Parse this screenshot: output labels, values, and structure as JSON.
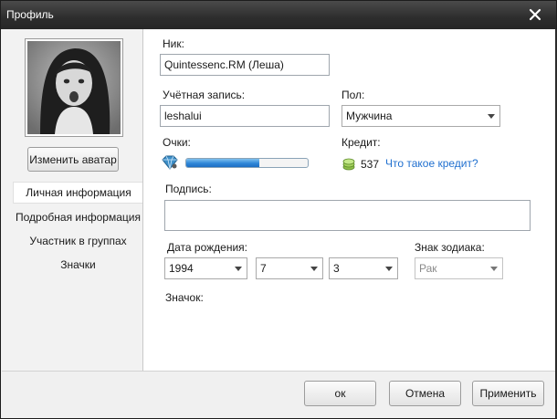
{
  "window": {
    "title": "Профиль"
  },
  "sidebar": {
    "change_avatar": "Изменить аватар",
    "items": [
      {
        "label": "Личная информация",
        "active": true
      },
      {
        "label": "Подробная информация"
      },
      {
        "label": "Участник в группах"
      },
      {
        "label": "Значки"
      }
    ]
  },
  "form": {
    "nick_label": "Ник:",
    "nick_value": "Quintessenc.RM (Леша)",
    "account_label": "Учётная запись:",
    "account_value": "leshalui",
    "gender_label": "Пол:",
    "gender_value": "Мужчина",
    "points_label": "Очки:",
    "points_progress": 0.6,
    "credit_label": "Кредит:",
    "credit_value": "537",
    "credit_link": "Что такое кредит?",
    "signature_label": "Подпись:",
    "signature_value": "",
    "birthdate_label": "Дата рождения:",
    "birth_year": "1994",
    "birth_month": "7",
    "birth_day": "3",
    "zodiac_label": "Знак зодиака:",
    "zodiac_value": "Рак",
    "badge_label": "Значок:"
  },
  "footer": {
    "ok": "ок",
    "cancel": "Отмена",
    "apply": "Применить"
  },
  "colors": {
    "accent": "#2f86d8",
    "link": "#1f6fcf",
    "titlebar": "#2d2d2d"
  }
}
